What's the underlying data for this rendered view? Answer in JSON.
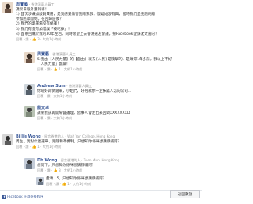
{
  "posts": [
    {
      "author": "周寶藝",
      "via": "· 香港演藝人員工",
      "lines": [
        "識果日報外賣報導！",
        "1) 首次涉嫌加敲劇費用，是我感覺傷害我剛我我：慢疑她沒有興，當時我們是先跑刷總",
        "參加民眾開始，在回歸區後？",
        "2) 我們的奧運場沒有保護！",
        "3) 我們有沒有加錯誤「被吃掉」！",
        "4) 首條回購於我的30年左右，同時希望上去香港選友會議，把Facebook登錄沈文嘉的！"
      ],
      "actions": "回覆 · 讚 · 👍 3 · 大約1小時前"
    },
    {
      "author": "周寶藝",
      "via": "· 香港演藝人員工",
      "lines": [
        "5)我由【人民力量】的【自由】就去 [人民] 是衝擊的，是徵得1年多前，我以上不好",
        "「人民力量」副黨！"
      ],
      "actions": "回覆 · 讚 · 👍 1 · 大約1小時前"
    },
    {
      "author": "Andrew Sum",
      "via": "· 香港演藝人員工",
      "lines": [
        "你唔好再倒遲車，小姐們，好抱歉你一定抹匙人怎的公司..."
      ],
      "actions": "回覆 · 讚 · 大約1小時前"
    },
    {
      "author": "龍文卓",
      "via": "",
      "lines": [
        "識果我該再開場會議理，皆事人會走出來回頭XXXXXXXD"
      ],
      "actions": "回覆 · 讚 · 大約1小時前"
    },
    {
      "author": "Billie Wong",
      "via": "· 留言香港的人 · Wah Yan College, Hong Kong",
      "lines": [
        "周生，我對什麼選舉，跟隨和革機制，只想知你係咪想講靜鋪阿？"
      ],
      "actions": "回覆 · 讚 · 👍 1 · 大約1小時前"
    },
    {
      "author": "Db Wong",
      "via": "· 留言香港的人 · Tuen Mun, Hong Kong",
      "lines": [
        "想問下，只想知你係咪想講靜鋪阿？"
      ],
      "actions": "回覆 · 讚 · 👍 3 · 大約1小時前"
    }
  ],
  "reply": {
    "author": "Db Wong",
    "lines": [
      "盧頌 | 5，只想知你係咪想講靜鋪阿？"
    ],
    "actions": "回覆 · 讚 · 👍 1 · 大約1小時前"
  },
  "footer": {
    "plugin_label": "Facebook 社群外掛程序"
  },
  "back_top_label": "返回數頂",
  "colors": {
    "link": "#3b5998",
    "meta": "#999999"
  }
}
